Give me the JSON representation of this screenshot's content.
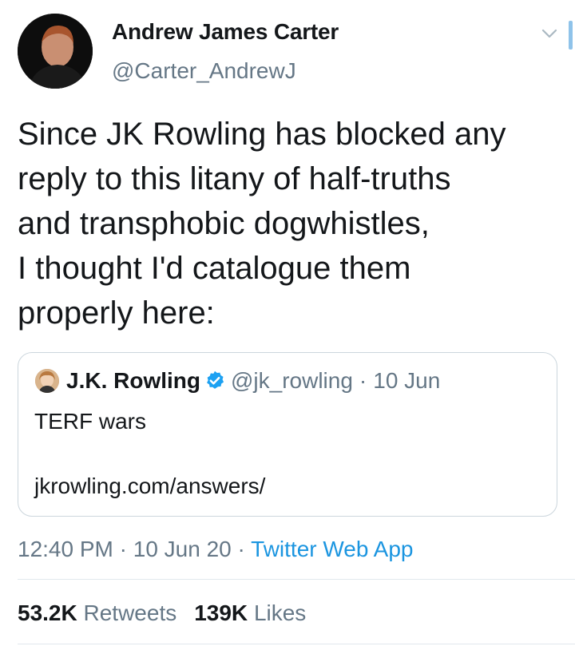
{
  "author": {
    "display_name": "Andrew James Carter",
    "handle": "@Carter_AndrewJ",
    "avatar_icon": "user-avatar"
  },
  "tweet": {
    "text_lines": [
      "Since JK Rowling has blocked any",
      "reply to this litany of half-truths",
      "and transphobic dogwhistles,",
      "I thought I'd catalogue them",
      "properly here:"
    ]
  },
  "quoted_tweet": {
    "display_name": "J.K. Rowling",
    "verified": true,
    "handle": "@jk_rowling",
    "separator": "·",
    "date": "10 Jun",
    "text": "TERF wars",
    "link": "jkrowling.com/answers/"
  },
  "meta": {
    "time": "12:40 PM",
    "separator": "·",
    "date": "10 Jun 20",
    "source": "Twitter Web App"
  },
  "stats": {
    "retweets_count": "53.2K",
    "retweets_label": "Retweets",
    "likes_count": "139K",
    "likes_label": "Likes"
  },
  "colors": {
    "link_blue": "#1b95e0",
    "secondary_text": "#657786",
    "verified_blue": "#1da1f2",
    "border": "#ccd6dd"
  }
}
